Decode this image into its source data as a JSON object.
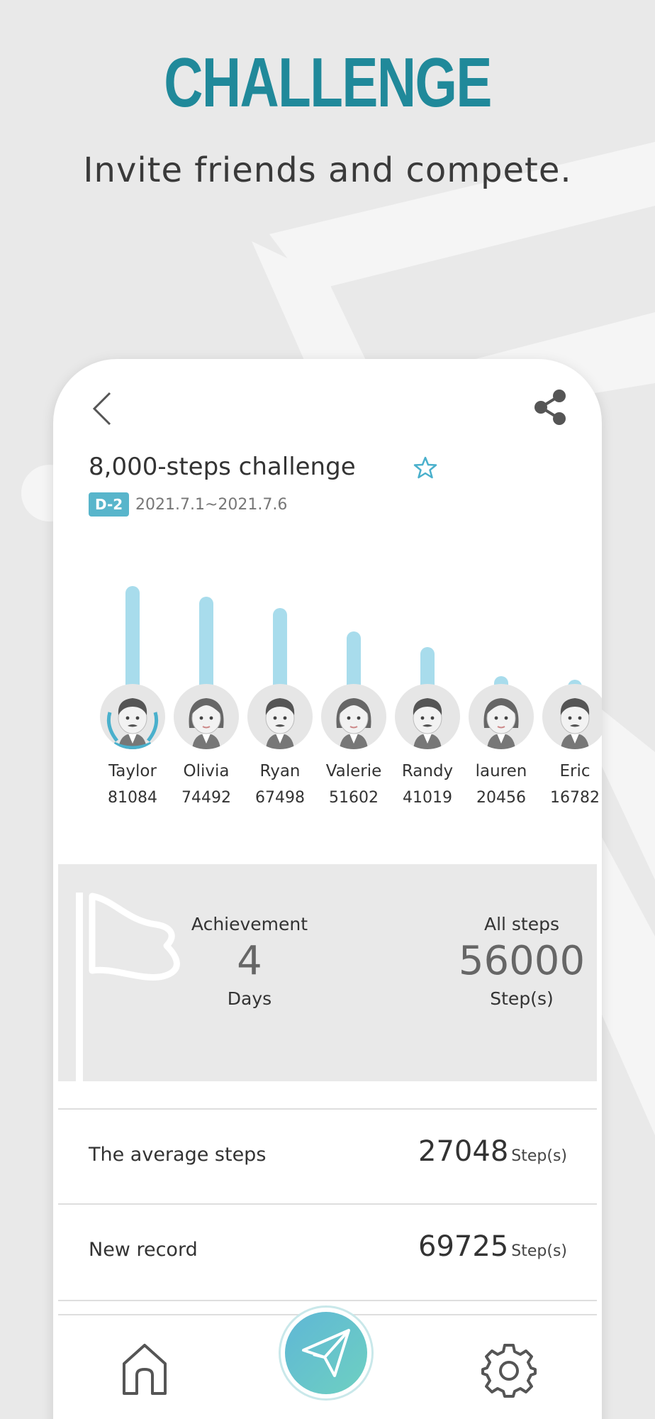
{
  "promo": {
    "title": "CHALLENGE",
    "subtitle": "Invite friends and compete."
  },
  "header": {
    "back_icon": "chevron-left-icon",
    "share_icon": "share-icon"
  },
  "challenge": {
    "title": "8,000-steps challenge",
    "favorite_icon": "star-outline-icon",
    "dday": "D-2",
    "date_range": "2021.7.1~2021.7.6"
  },
  "ranking": [
    {
      "name": "Taylor",
      "steps": "81084",
      "avatar": "male",
      "laurel": true
    },
    {
      "name": "Olivia",
      "steps": "74492",
      "avatar": "female",
      "laurel": false
    },
    {
      "name": "Ryan",
      "steps": "67498",
      "avatar": "male",
      "laurel": false
    },
    {
      "name": "Valerie",
      "steps": "51602",
      "avatar": "female",
      "laurel": false
    },
    {
      "name": "Randy",
      "steps": "41019",
      "avatar": "male",
      "laurel": false
    },
    {
      "name": "lauren",
      "steps": "20456",
      "avatar": "female",
      "laurel": false
    },
    {
      "name": "Eric",
      "steps": "16782",
      "avatar": "male",
      "laurel": false
    }
  ],
  "summary": {
    "achievement_label": "Achievement",
    "achievement_value": "4",
    "achievement_unit": "Days",
    "all_steps_label": "All steps",
    "all_steps_value": "56000",
    "all_steps_unit": "Step(s)"
  },
  "stats": {
    "average_label": "The average steps",
    "average_value": "27048",
    "average_unit": "Step(s)",
    "record_label": "New record",
    "record_value": "69725",
    "record_unit": "Step(s)"
  },
  "nav": {
    "home_icon": "home-icon",
    "send_icon": "send-icon",
    "settings_icon": "gear-icon"
  },
  "colors": {
    "accent": "#20899a",
    "bar": "#a8dcec",
    "badge": "#58b5cb",
    "background": "#e9e9e9"
  }
}
